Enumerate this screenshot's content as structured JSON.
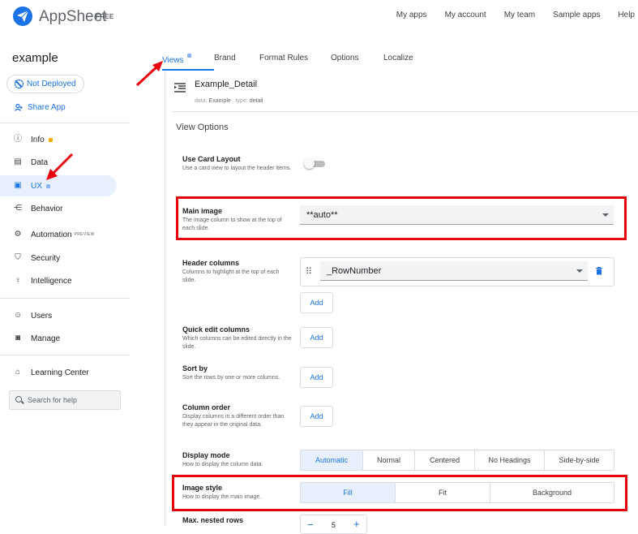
{
  "header": {
    "brand": "AppSheet",
    "brand_tag": "FREE",
    "nav": [
      "My apps",
      "My account",
      "My team",
      "Sample apps",
      "Help"
    ]
  },
  "sidebar": {
    "app_name": "example",
    "deploy_status": "Not Deployed",
    "share": "Share App",
    "items": [
      {
        "label": "Info",
        "icon": "info-icon"
      },
      {
        "label": "Data",
        "icon": "data-icon"
      },
      {
        "label": "UX",
        "icon": "ux-icon"
      },
      {
        "label": "Behavior",
        "icon": "behavior-icon"
      },
      {
        "label": "Automation",
        "icon": "automation-icon",
        "badge": "PREVIEW"
      },
      {
        "label": "Security",
        "icon": "shield-icon"
      },
      {
        "label": "Intelligence",
        "icon": "bulb-icon"
      },
      {
        "label": "Users",
        "icon": "users-icon"
      },
      {
        "label": "Manage",
        "icon": "manage-icon"
      },
      {
        "label": "Learning Center",
        "icon": "school-icon"
      }
    ],
    "search_placeholder": "Search for help"
  },
  "tabs": [
    "Views",
    "Brand",
    "Format Rules",
    "Options",
    "Localize"
  ],
  "view": {
    "name": "Example_Detail",
    "data_label": "data:",
    "data_value": "Example",
    "type_label": "type:",
    "type_value": "detail",
    "section_title": "View Options"
  },
  "options": {
    "card_layout": {
      "title": "Use Card Layout",
      "desc": "Use a card view to layout the header items.",
      "on": false
    },
    "main_image": {
      "title": "Main image",
      "desc": "The image column to show at the top of each slide.",
      "value": "**auto**"
    },
    "header_columns": {
      "title": "Header columns",
      "desc": "Columns to highlight at the top of each slide.",
      "value": "_RowNumber",
      "add": "Add"
    },
    "quick_edit": {
      "title": "Quick edit columns",
      "desc": "Which columns can be edited directly in the slide.",
      "add": "Add"
    },
    "sort_by": {
      "title": "Sort by",
      "desc": "Sort the rows by one or more columns.",
      "add": "Add"
    },
    "column_order": {
      "title": "Column order",
      "desc": "Display columns in a different order than they appear in the original data.",
      "add": "Add"
    },
    "display_mode": {
      "title": "Display mode",
      "desc": "How to display the column data.",
      "choices": [
        "Automatic",
        "Normal",
        "Centered",
        "No Headings",
        "Side-by-side"
      ],
      "selected": "Automatic"
    },
    "image_style": {
      "title": "Image style",
      "desc": "How to display the main image.",
      "choices": [
        "Fill",
        "Fit",
        "Background"
      ],
      "selected": "Fill"
    },
    "max_nested": {
      "title": "Max. nested rows",
      "value": "5"
    }
  },
  "colors": {
    "accent": "#1a73e8",
    "annotation_red": "#e8000c",
    "info_dot": "#f9ab00"
  }
}
